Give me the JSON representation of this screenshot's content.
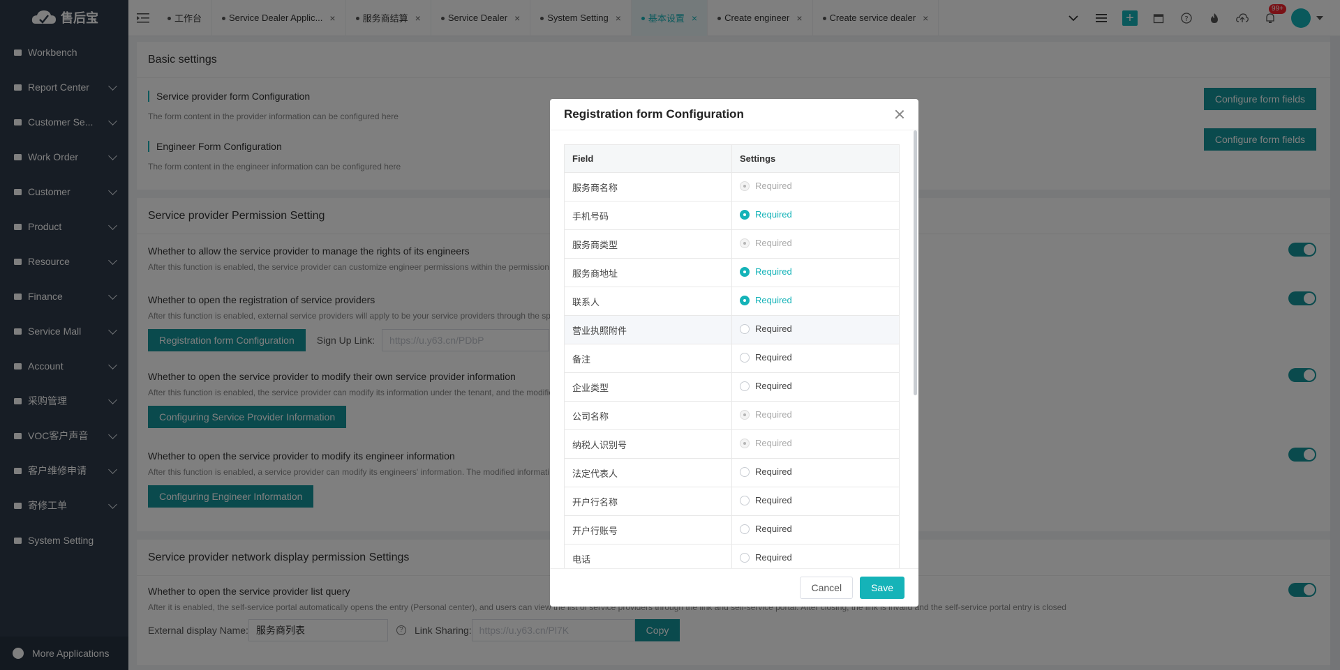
{
  "app": {
    "logo_text": "售后宝"
  },
  "sidebar": {
    "items": [
      {
        "label": "Workbench",
        "icon": "home-icon",
        "expandable": false
      },
      {
        "label": "Report Center",
        "icon": "chart-icon",
        "expandable": true
      },
      {
        "label": "Customer Se...",
        "icon": "customer-service-icon",
        "expandable": true
      },
      {
        "label": "Work Order",
        "icon": "work-order-icon",
        "expandable": true
      },
      {
        "label": "Customer",
        "icon": "customer-icon",
        "expandable": true
      },
      {
        "label": "Product",
        "icon": "product-icon",
        "expandable": true
      },
      {
        "label": "Resource",
        "icon": "resource-icon",
        "expandable": true
      },
      {
        "label": "Finance",
        "icon": "finance-icon",
        "expandable": true
      },
      {
        "label": "Service Mall",
        "icon": "mall-icon",
        "expandable": true
      },
      {
        "label": "Account",
        "icon": "account-icon",
        "expandable": true
      },
      {
        "label": "采购管理",
        "icon": "purchase-icon",
        "expandable": true
      },
      {
        "label": "VOC客户声音",
        "icon": "voc-icon",
        "expandable": true
      },
      {
        "label": "客户维修申请",
        "icon": "repair-request-icon",
        "expandable": true
      },
      {
        "label": "寄修工单",
        "icon": "mail-repair-icon",
        "expandable": true
      },
      {
        "label": "System Setting",
        "icon": "gear-icon",
        "expandable": false
      }
    ],
    "more_apps": "More Applications"
  },
  "tabs": [
    {
      "label": "工作台",
      "active": false
    },
    {
      "label": "Service Dealer Applic...",
      "active": false
    },
    {
      "label": "服务商结算",
      "active": false
    },
    {
      "label": "Service Dealer",
      "active": false
    },
    {
      "label": "System Setting",
      "active": false
    },
    {
      "label": "基本设置",
      "active": true
    },
    {
      "label": "Create engineer",
      "active": false
    },
    {
      "label": "Create service dealer",
      "active": false
    }
  ],
  "topbar": {
    "notification_badge": "99+"
  },
  "basic": {
    "title": "Basic settings",
    "provider_form": {
      "heading": "Service provider form Configuration",
      "desc": "The form content in the provider information can be configured here",
      "button": "Configure form fields"
    },
    "engineer_form": {
      "heading": "Engineer Form Configuration",
      "desc": "The form content in the engineer information can be configured here",
      "button": "Configure form fields"
    }
  },
  "permission": {
    "title": "Service provider Permission Setting",
    "rows": [
      {
        "title": "Whether to allow the service provider to manage the rights of its engineers",
        "desc": "After this function is enabled, the service provider can customize engineer permissions within the permission"
      },
      {
        "title": "Whether to open the registration of service providers",
        "desc": "After this function is enabled, external service providers will apply to be your service providers through the sp"
      },
      {
        "title": "Whether to open the service provider to modify their own service provider information",
        "desc": "After this function is enabled, the service provider can modify its information under the tenant, and the modifie"
      },
      {
        "title": "Whether to open the service provider to modify its engineer information",
        "desc": "After this function is enabled, a service provider can modify its engineers' information. The modified informati"
      }
    ],
    "reg_button": "Registration form Configuration",
    "signup_label": "Sign Up Link:",
    "signup_value": "https://u.y63.cn/PDbP",
    "provider_info_button": "Configuring Service Provider Information",
    "engineer_info_button": "Configuring Engineer Information"
  },
  "network": {
    "title": "Service provider network display permission Settings",
    "row_title": "Whether to open the service provider list query",
    "row_desc": "After it is enabled, the self-service portal automatically opens the entry (Personal center), and users can view the list of service providers through the link and self-service portal. After closing, the link is invalid and the self-service portal entry is closed",
    "display_name_label": "External display Name:",
    "display_name_value": "服务商列表",
    "link_label": "Link Sharing:",
    "link_value": "https://u.y63.cn/Pl7K",
    "copy_button": "Copy"
  },
  "modal": {
    "title": "Registration form Configuration",
    "col_field": "Field",
    "col_settings": "Settings",
    "rows": [
      {
        "field": "服务商名称",
        "setting": "Required",
        "state": "disabled"
      },
      {
        "field": "手机号码",
        "setting": "Required",
        "state": "checked"
      },
      {
        "field": "服务商类型",
        "setting": "Required",
        "state": "disabled"
      },
      {
        "field": "服务商地址",
        "setting": "Required",
        "state": "checked"
      },
      {
        "field": "联系人",
        "setting": "Required",
        "state": "checked"
      },
      {
        "field": "营业执照附件",
        "setting": "Required",
        "state": "unchecked"
      },
      {
        "field": "备注",
        "setting": "Required",
        "state": "unchecked"
      },
      {
        "field": "企业类型",
        "setting": "Required",
        "state": "unchecked"
      },
      {
        "field": "公司名称",
        "setting": "Required",
        "state": "disabled"
      },
      {
        "field": "纳税人识别号",
        "setting": "Required",
        "state": "disabled"
      },
      {
        "field": "法定代表人",
        "setting": "Required",
        "state": "unchecked"
      },
      {
        "field": "开户行名称",
        "setting": "Required",
        "state": "unchecked"
      },
      {
        "field": "开户行账号",
        "setting": "Required",
        "state": "unchecked"
      },
      {
        "field": "电话",
        "setting": "Required",
        "state": "unchecked"
      }
    ],
    "cancel": "Cancel",
    "save": "Save"
  },
  "colors": {
    "accent": "#15b3b8",
    "button_teal": "#14949a",
    "sidebar_bg": "#2e3a4a"
  }
}
